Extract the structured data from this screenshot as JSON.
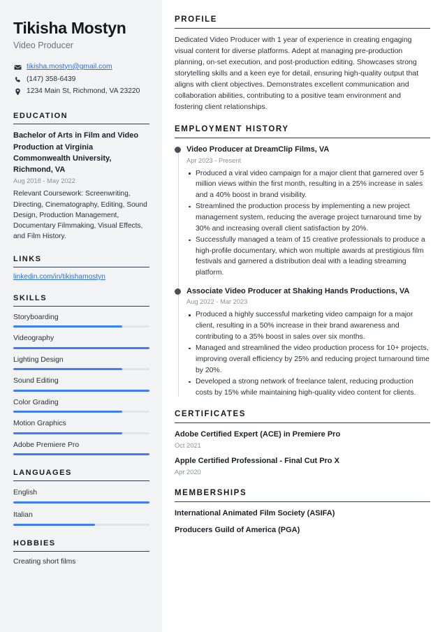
{
  "theme": {
    "accent": "#3b7ef5",
    "link": "#2f6fe0",
    "sidebar_bg": "#f2f3f5",
    "heading": "#16181d",
    "muted": "#8b9099"
  },
  "header": {
    "name": "Tikisha Mostyn",
    "role": "Video Producer",
    "contacts": [
      {
        "icon": "envelope-icon",
        "text": "tikisha.mostyn@gmail.com",
        "is_link": true
      },
      {
        "icon": "phone-icon",
        "text": "(147) 358-6439",
        "is_link": false
      },
      {
        "icon": "location-pin-icon",
        "text": "1234 Main St, Richmond, VA 23220",
        "is_link": false
      }
    ]
  },
  "sidebar": {
    "education": {
      "title": "EDUCATION",
      "entries": [
        {
          "degree": "Bachelor of Arts in Film and Video Production at Virginia Commonwealth University, Richmond, VA",
          "date": "Aug 2018 - May 2022",
          "description": "Relevant Coursework: Screenwriting, Directing, Cinematography, Editing, Sound Design, Production Management, Documentary Filmmaking, Visual Effects, and Film History."
        }
      ]
    },
    "links": {
      "title": "LINKS",
      "items": [
        {
          "label": "linkedin.com/in/tikishamostyn"
        }
      ]
    },
    "skills": {
      "title": "SKILLS",
      "items": [
        {
          "name": "Storyboarding",
          "level": 80
        },
        {
          "name": "Videography",
          "level": 100
        },
        {
          "name": "Lighting Design",
          "level": 80
        },
        {
          "name": "Sound Editing",
          "level": 100
        },
        {
          "name": "Color Grading",
          "level": 80
        },
        {
          "name": "Motion Graphics",
          "level": 80
        },
        {
          "name": "Adobe Premiere Pro",
          "level": 100
        }
      ]
    },
    "languages": {
      "title": "LANGUAGES",
      "items": [
        {
          "name": "English",
          "level": 100
        },
        {
          "name": "Italian",
          "level": 60
        }
      ]
    },
    "hobbies": {
      "title": "HOBBIES",
      "items": [
        {
          "text": "Creating short films"
        }
      ]
    }
  },
  "main": {
    "profile": {
      "title": "PROFILE",
      "text": "Dedicated Video Producer with 1 year of experience in creating engaging visual content for diverse platforms. Adept at managing pre-production planning, on-set execution, and post-production editing. Showcases strong storytelling skills and a keen eye for detail, ensuring high-quality output that aligns with client objectives. Demonstrates excellent communication and collaboration abilities, contributing to a positive team environment and fostering client relationships."
    },
    "employment": {
      "title": "EMPLOYMENT HISTORY",
      "jobs": [
        {
          "title": "Video Producer at DreamClip Films, VA",
          "date": "Apr 2023 - Present",
          "bullets": [
            "Produced a viral video campaign for a major client that garnered over 5 million views within the first month, resulting in a 25% increase in sales and a 40% boost in brand visibility.",
            "Streamlined the production process by implementing a new project management system, reducing the average project turnaround time by 30% and increasing overall client satisfaction by 20%.",
            "Successfully managed a team of 15 creative professionals to produce a high-profile documentary, which won multiple awards at prestigious film festivals and garnered a distribution deal with a leading streaming platform."
          ]
        },
        {
          "title": "Associate Video Producer at Shaking Hands Productions, VA",
          "date": "Aug 2022 - Mar 2023",
          "bullets": [
            "Produced a highly successful marketing video campaign for a major client, resulting in a 50% increase in their brand awareness and contributing to a 35% boost in sales over six months.",
            "Managed and streamlined the video production process for 10+ projects, improving overall efficiency by 25% and reducing project turnaround time by 20%.",
            "Developed a strong network of freelance talent, reducing production costs by 15% while maintaining high-quality video content for clients."
          ]
        }
      ]
    },
    "certificates": {
      "title": "CERTIFICATES",
      "items": [
        {
          "name": "Adobe Certified Expert (ACE) in Premiere Pro",
          "date": "Oct 2021"
        },
        {
          "name": "Apple Certified Professional - Final Cut Pro X",
          "date": "Apr 2020"
        }
      ]
    },
    "memberships": {
      "title": "MEMBERSHIPS",
      "items": [
        {
          "name": "International Animated Film Society (ASIFA)"
        },
        {
          "name": "Producers Guild of America (PGA)"
        }
      ]
    }
  }
}
